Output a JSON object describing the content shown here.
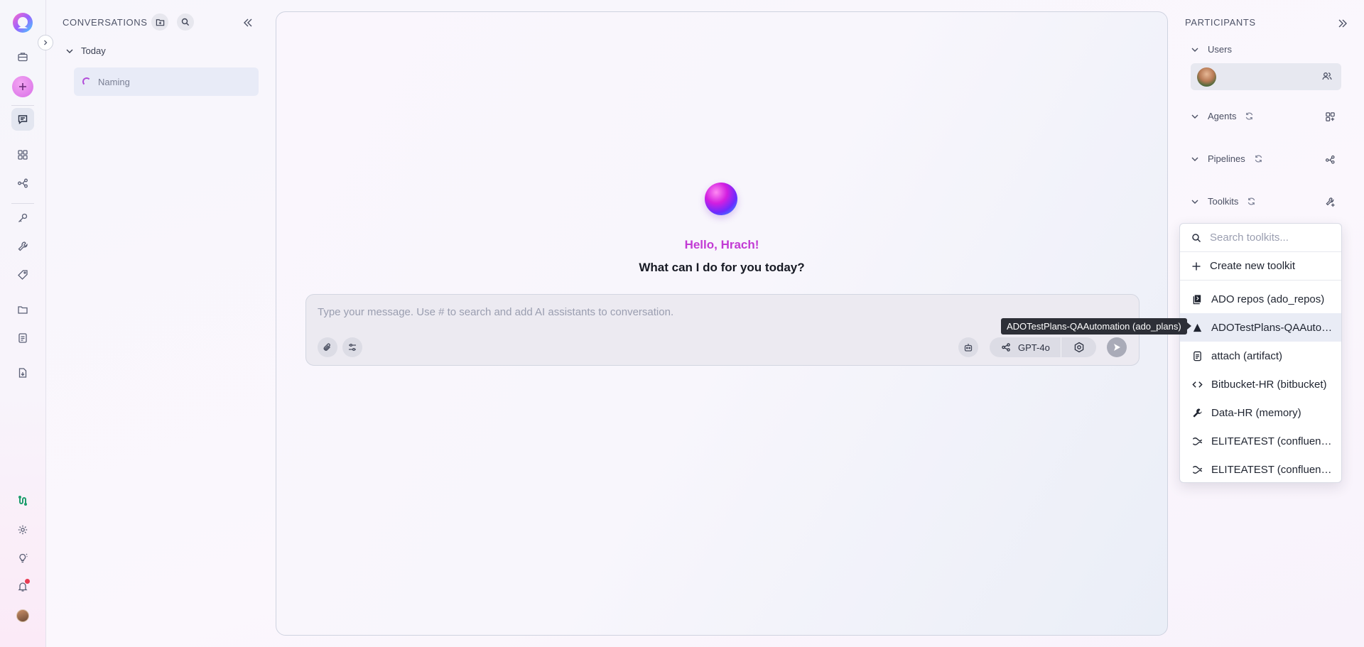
{
  "rail": {
    "items": [
      {
        "name": "app-logo",
        "icon": "logo"
      },
      {
        "name": "briefcase",
        "icon": "briefcase-icon"
      },
      {
        "name": "new-chat",
        "icon": "plus-icon"
      },
      {
        "name": "chat",
        "icon": "chat-icon",
        "active": true
      },
      {
        "name": "grid",
        "icon": "grid-icon"
      },
      {
        "name": "pipelines",
        "icon": "flow-icon"
      },
      {
        "name": "keys",
        "icon": "key-icon"
      },
      {
        "name": "tools",
        "icon": "wrench-icon"
      },
      {
        "name": "tags",
        "icon": "tag-icon"
      },
      {
        "name": "folder",
        "icon": "folder-icon"
      },
      {
        "name": "artifacts",
        "icon": "document-icon"
      },
      {
        "name": "export",
        "icon": "file-export-icon"
      },
      {
        "name": "integrations",
        "icon": "integration-icon"
      },
      {
        "name": "settings",
        "icon": "gear-icon"
      },
      {
        "name": "ideas",
        "icon": "bulb-icon"
      },
      {
        "name": "notifications",
        "icon": "bell-icon"
      },
      {
        "name": "profile",
        "icon": "avatar"
      }
    ]
  },
  "conversations": {
    "title": "CONVERSATIONS",
    "group_label": "Today",
    "item_label": "Naming"
  },
  "main": {
    "greeting": "Hello, Hrach!",
    "question": "What can I do for you today?",
    "composer_placeholder": "Type your message. Use # to search and add AI assistants to conversation.",
    "model_label": "GPT-4o"
  },
  "participants": {
    "title": "PARTICIPANTS",
    "sections": {
      "users": "Users",
      "agents": "Agents",
      "pipelines": "Pipelines",
      "toolkits": "Toolkits"
    }
  },
  "toolkit_dropdown": {
    "search_placeholder": "Search toolkits...",
    "create_label": "Create new toolkit",
    "items": [
      {
        "label": "ADO repos (ado_repos)",
        "icon": "repo-icon"
      },
      {
        "label": "ADOTestPlans-QAAutomation (ado_plans)",
        "icon": "ado-plans-icon",
        "hover": true
      },
      {
        "label": "attach (artifact)",
        "icon": "artifact-icon"
      },
      {
        "label": "Bitbucket-HR (bitbucket)",
        "icon": "code-icon"
      },
      {
        "label": "Data-HR (memory)",
        "icon": "wrench-icon"
      },
      {
        "label": "ELITEATEST (confluence)",
        "icon": "confluence-icon"
      },
      {
        "label": "ELITEATEST (confluence)",
        "icon": "confluence-icon"
      }
    ]
  },
  "tooltip": "ADOTestPlans-QAAutomation (ado_plans)",
  "colors": {
    "accent": "#c23bd4",
    "sidebar_active": "#e3e6f0",
    "conversation_selected": "#e8ebf7"
  }
}
